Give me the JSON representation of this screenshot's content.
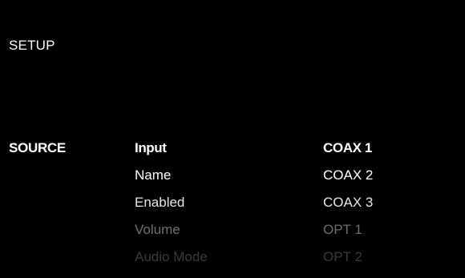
{
  "screen": {
    "title": "SETUP",
    "section": "SOURCE"
  },
  "menu": {
    "items": [
      {
        "label": "Input",
        "selected": true
      },
      {
        "label": "Name",
        "selected": false
      },
      {
        "label": "Enabled",
        "selected": false
      },
      {
        "label": "Volume",
        "selected": false
      },
      {
        "label": "Audio Mode",
        "selected": false
      }
    ]
  },
  "values": {
    "items": [
      {
        "label": "COAX 1",
        "selected": true
      },
      {
        "label": "COAX 2",
        "selected": false
      },
      {
        "label": "COAX 3",
        "selected": false
      },
      {
        "label": "OPT 1",
        "selected": false
      },
      {
        "label": "OPT 2",
        "selected": false
      }
    ]
  },
  "colors": {
    "background": "#000000",
    "text": "#ffffff",
    "dimmed": "#6e6e6e",
    "faint": "#3a3a3a"
  }
}
